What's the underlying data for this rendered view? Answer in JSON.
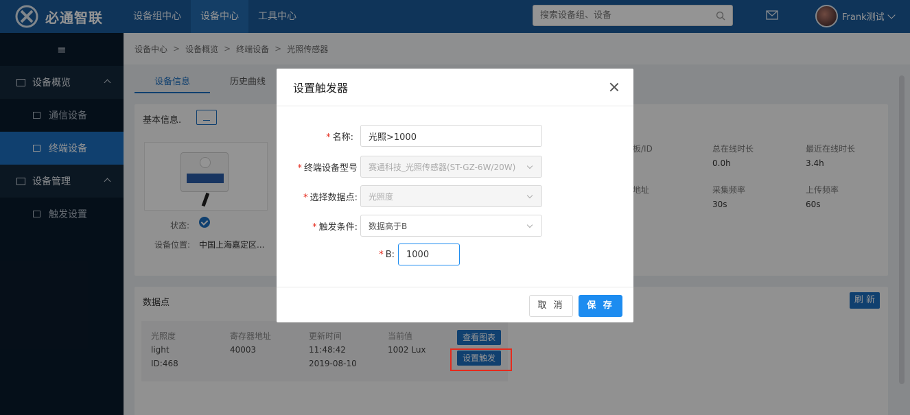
{
  "header": {
    "logo_text": "必通智联",
    "nav": [
      "设备组中心",
      "设备中心",
      "工具中心"
    ],
    "active_nav": 1,
    "search_placeholder": "搜索设备组、设备",
    "user_name": "Frank测试"
  },
  "sidebar": {
    "collapse_icon": "≡",
    "groups": [
      {
        "label": "设备概览",
        "items": [
          "通信设备",
          "终端设备"
        ]
      },
      {
        "label": "设备管理",
        "items": [
          "触发设置"
        ]
      }
    ],
    "active_item": "终端设备"
  },
  "breadcrumb": [
    "设备中心",
    "设备概览",
    "终端设备",
    "光照传感器"
  ],
  "tabs": [
    "设备信息",
    "历史曲线"
  ],
  "basic_info": {
    "title": "基本信息.",
    "status_label": "状态:",
    "location_label": "设备位置:",
    "location_value": "中国上海嘉定区...",
    "columns": [
      {
        "k": "板/ID",
        "v": ""
      },
      {
        "k": "总在线时长",
        "v": "0.0h"
      },
      {
        "k": "最近在线时长",
        "v": "3.4h"
      },
      {
        "k": "地址",
        "v": ""
      },
      {
        "k": "采集频率",
        "v": "30s"
      },
      {
        "k": "上传频率",
        "v": "60s"
      }
    ]
  },
  "datapoints": {
    "title": "数据点",
    "refresh": "刷 新",
    "item": {
      "name_lines": [
        "光照度",
        "light",
        "ID:468"
      ],
      "reg_label": "寄存器地址",
      "reg_value": "40003",
      "time_label": "更新时间",
      "time_value": "11:48:42",
      "date_value": "2019-08-10",
      "cur_label": "当前值",
      "cur_value": "1002 Lux",
      "btn_chart": "查看图表",
      "btn_trigger": "设置触发"
    }
  },
  "modal": {
    "title": "设置触发器",
    "fields": {
      "name_label": "名称:",
      "name_value": "光照>1000",
      "model_label": "终端设备型号",
      "model_value": "赛通科技_光照传感器(ST-GZ-6W/20W)",
      "point_label": "选择数据点:",
      "point_value": "光照度",
      "cond_label": "触发条件:",
      "cond_value": "数据高于B",
      "b_label": "B:",
      "b_value": "1000"
    },
    "cancel": "取 消",
    "save": "保 存"
  },
  "colors": {
    "primary": "#1d6fc0",
    "header": "#1a5a9a",
    "sidebar": "#0a1a2b",
    "danger": "#e52a1c"
  }
}
